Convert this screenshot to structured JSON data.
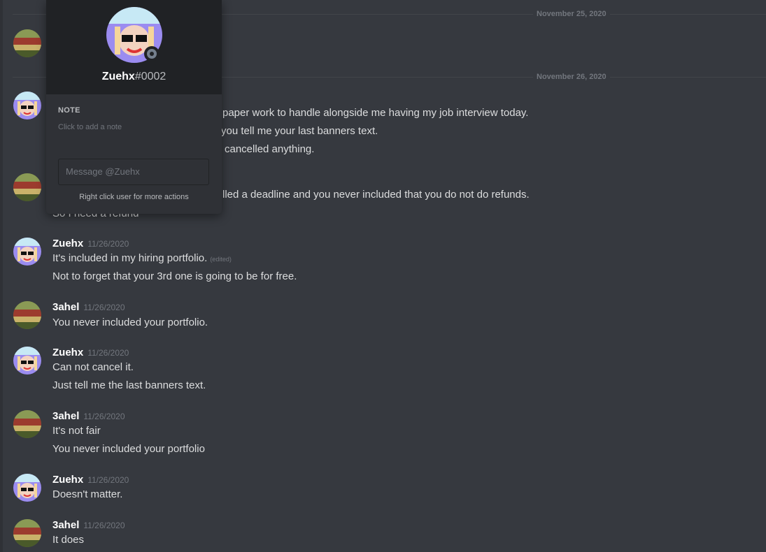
{
  "dividers": [
    {
      "date": "November 25, 2020"
    },
    {
      "date": "November 26, 2020"
    }
  ],
  "messages": [
    {
      "hidden_lines": [
        "paper work to handle alongside me having my job interview today.",
        "you tell me your last banners text.",
        "cancelled anything."
      ]
    },
    {
      "hidden_lines": [
        "lled a deadline and you never included that you do not do refunds.",
        "So I need a refund"
      ]
    },
    {
      "username": "Zuehx",
      "timestamp": "11/26/2020",
      "lines": [
        "It's included in my hiring portfolio.",
        "Not to forget that your 3rd one is going to be for free."
      ],
      "edited": "(edited)"
    },
    {
      "username": "3ahel",
      "timestamp": "11/26/2020",
      "lines": [
        "You never included your portfolio."
      ]
    },
    {
      "username": "Zuehx",
      "timestamp": "11/26/2020",
      "lines": [
        "Can not cancel it.",
        "Just tell me the last banners text."
      ]
    },
    {
      "username": "3ahel",
      "timestamp": "11/26/2020",
      "lines": [
        "It's not fair",
        "You never included your portfolio"
      ]
    },
    {
      "username": "Zuehx",
      "timestamp": "11/26/2020",
      "lines": [
        "Doesn't matter."
      ]
    },
    {
      "username": "3ahel",
      "timestamp": "11/26/2020",
      "lines": [
        "It does"
      ]
    }
  ],
  "popout": {
    "username": "Zuehx",
    "discriminator": "#0002",
    "status": "offline",
    "note_label": "NOTE",
    "note_placeholder": "Click to add a note",
    "message_placeholder": "Message @Zuehx",
    "hint": "Right click user for more actions"
  },
  "colors": {
    "background": "#36393f",
    "popout_header": "#202225",
    "popout_body": "#2f3136",
    "username": "#ffffff",
    "timestamp": "#72767d",
    "text": "#dcddde"
  }
}
